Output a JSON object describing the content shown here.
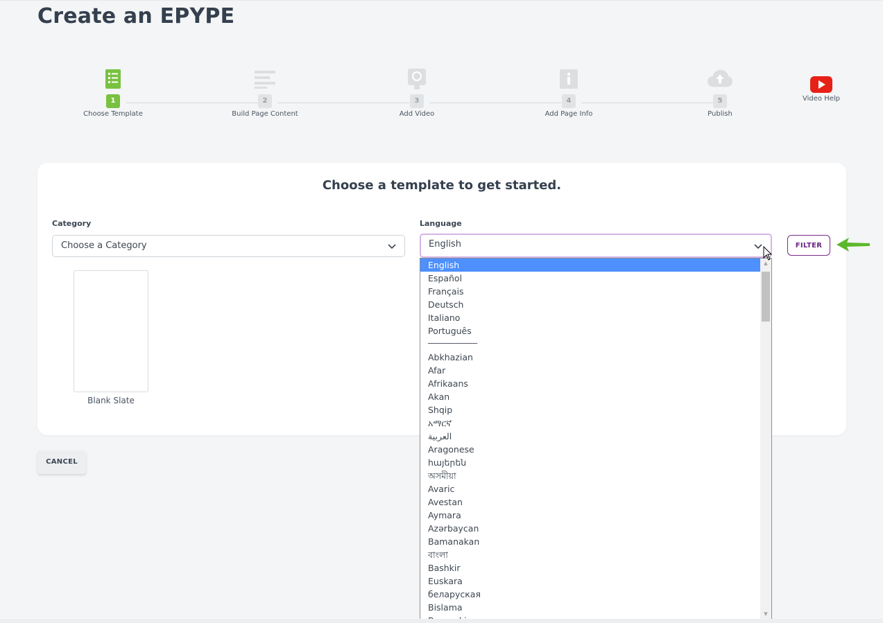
{
  "page": {
    "title": "Create an EPYPE"
  },
  "stepper": {
    "steps": [
      {
        "number": "1",
        "label": "Choose Template",
        "icon": "list-icon",
        "active": true
      },
      {
        "number": "2",
        "label": "Build Page Content",
        "icon": "lines-icon",
        "active": false
      },
      {
        "number": "3",
        "label": "Add Video",
        "icon": "video-camera-icon",
        "active": false
      },
      {
        "number": "4",
        "label": "Add Page Info",
        "icon": "info-icon",
        "active": false
      },
      {
        "number": "5",
        "label": "Publish",
        "icon": "cloud-upload-icon",
        "active": false
      }
    ],
    "video_help_label": "Video Help"
  },
  "card": {
    "heading": "Choose a template to get started.",
    "category": {
      "label": "Category",
      "value": "Choose a Category"
    },
    "language": {
      "label": "Language",
      "value": "English"
    },
    "filter_label": "FILTER",
    "template": {
      "label": "Blank Slate"
    }
  },
  "cancel_label": "CANCEL",
  "language_options": [
    "English",
    "Español",
    "Français",
    "Deutsch",
    "Italiano",
    "Português",
    "──────────────",
    "Abkhazian",
    "Afar",
    "Afrikaans",
    "Akan",
    "Shqip",
    "አማርኛ",
    "العربية",
    "Aragonese",
    "հայերեն",
    "অসমীয়া",
    "Avaric",
    "Avestan",
    "Aymara",
    "Azərbaycan",
    "Bamanakan",
    "বাংলা",
    "Bashkir",
    "Euskara",
    "беларуская",
    "Bislama",
    "Bosanski"
  ],
  "colors": {
    "active_step": "#7ac142",
    "brand_purple": "#7a2a8c",
    "selected_option": "#4d90fe",
    "arrow_green": "#5cb82a",
    "youtube_red": "#e62117"
  }
}
